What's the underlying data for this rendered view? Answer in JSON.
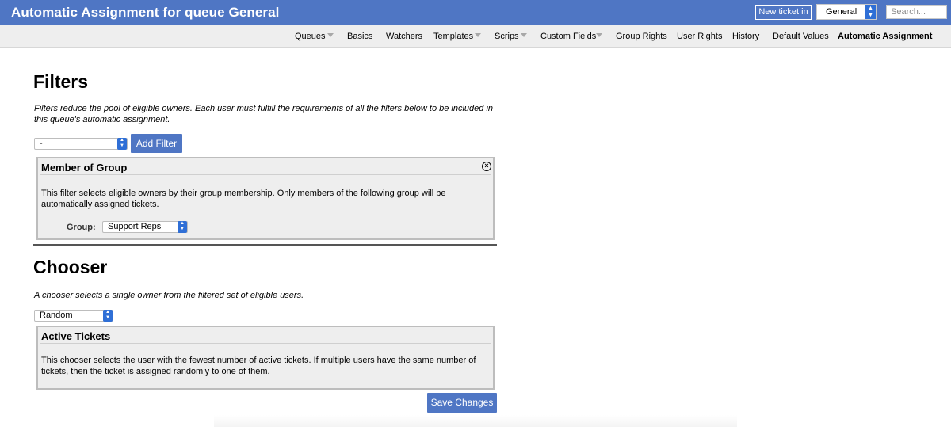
{
  "header": {
    "title": "Automatic Assignment for queue General",
    "new_ticket_label": "New ticket in",
    "queue_selected": "General",
    "search_placeholder": "Search..."
  },
  "nav": {
    "items": [
      {
        "label": "Queues",
        "has_menu": true
      },
      {
        "label": "Basics",
        "has_menu": false
      },
      {
        "label": "Watchers",
        "has_menu": false
      },
      {
        "label": "Templates",
        "has_menu": true
      },
      {
        "label": "Scrips",
        "has_menu": true
      },
      {
        "label": "Custom Fields",
        "has_menu": true
      },
      {
        "label": "Group Rights",
        "has_menu": false
      },
      {
        "label": "User Rights",
        "has_menu": false
      },
      {
        "label": "History",
        "has_menu": false
      },
      {
        "label": "Default Values",
        "has_menu": false
      },
      {
        "label": "Automatic Assignment",
        "has_menu": false,
        "active": true
      }
    ]
  },
  "filters": {
    "heading": "Filters",
    "description": "Filters reduce the pool of eligible owners. Each user must fulfill the requirements of all the filters below to be included in this queue's automatic assignment.",
    "select_value": "-",
    "add_button": "Add Filter",
    "panel": {
      "title": "Member of Group",
      "description": "This filter selects eligible owners by their group membership. Only members of the following group will be automatically assigned tickets.",
      "group_label": "Group:",
      "group_value": "Support Reps"
    }
  },
  "chooser": {
    "heading": "Chooser",
    "description": "A chooser selects a single owner from the filtered set of eligible users.",
    "select_value": "Random",
    "panel": {
      "title": "Active Tickets",
      "description": "This chooser selects the user with the fewest number of active tickets. If multiple users have the same number of tickets, then the ticket is assigned randomly to one of them."
    }
  },
  "save_button": "Save Changes",
  "colors": {
    "header_bg": "#4f76c4",
    "button_bg": "#4f76c4",
    "nav_bg": "#eeeeee",
    "panel_bg": "#eeeeee",
    "select_accent": "#2f6fd6"
  }
}
